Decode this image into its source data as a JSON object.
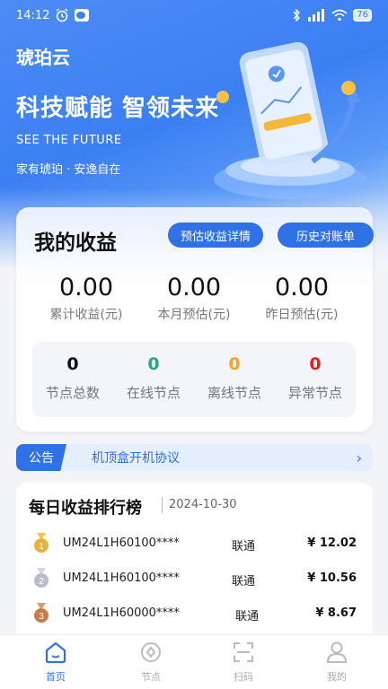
{
  "status_bar": {
    "time": "14:12",
    "battery": "76"
  },
  "header": {
    "app_title": "琥珀云",
    "slogan": "科技赋能 智领未来",
    "slogan_en": "SEE THE FUTURE",
    "slogan_sub": "家有琥珀 · 安逸自在"
  },
  "income": {
    "title": "我的收益",
    "estimate_btn": "预估收益详情",
    "history_btn": "历史对账单",
    "stats": [
      {
        "value": "0.00",
        "label": "累计收益(元)"
      },
      {
        "value": "0.00",
        "label": "本月预估(元)"
      },
      {
        "value": "0.00",
        "label": "昨日预估(元)"
      }
    ],
    "nodes": [
      {
        "count": "0",
        "label": "节点总数",
        "color": "#111111"
      },
      {
        "count": "0",
        "label": "在线节点",
        "color": "#2aa876"
      },
      {
        "count": "0",
        "label": "离线节点",
        "color": "#f5a623"
      },
      {
        "count": "0",
        "label": "异常节点",
        "color": "#e02020"
      }
    ]
  },
  "notice": {
    "tag": "公告",
    "text": "机顶盒开机协议",
    "arrow": "›"
  },
  "ranking": {
    "title": "每日收益排行榜",
    "date": "2024-10-30",
    "rows": [
      {
        "rank": "1",
        "id": "UM24L1H60100****",
        "operator": "联通",
        "amount": "¥ 12.02"
      },
      {
        "rank": "2",
        "id": "UM24L1H60100****",
        "operator": "联通",
        "amount": "¥ 10.56"
      },
      {
        "rank": "3",
        "id": "UM24L1H60000****",
        "operator": "联通",
        "amount": "¥ 8.67"
      }
    ]
  },
  "nav": [
    {
      "label": "首页",
      "icon": "home-icon"
    },
    {
      "label": "节点",
      "icon": "node-icon"
    },
    {
      "label": "扫码",
      "icon": "scan-icon"
    },
    {
      "label": "我的",
      "icon": "user-icon"
    }
  ],
  "colors": {
    "primary": "#2f72e8",
    "gold": "#e8b33a",
    "silver": "#b9bdc7",
    "bronze": "#c77a4a"
  }
}
